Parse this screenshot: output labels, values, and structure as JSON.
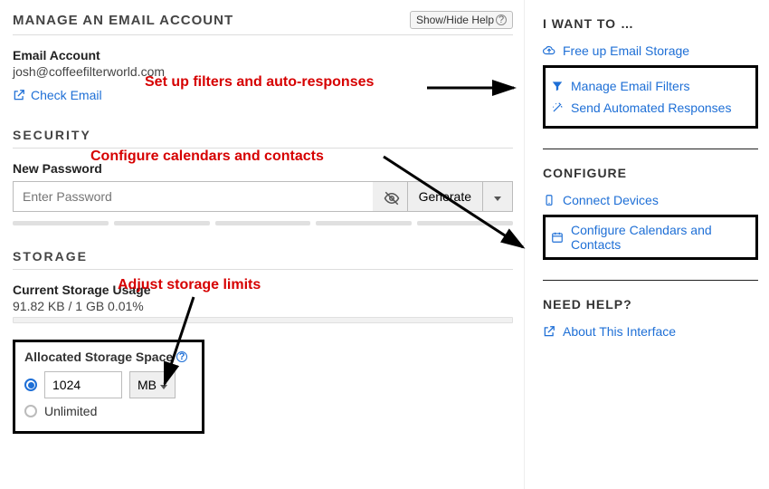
{
  "header": {
    "title": "Manage an Email Account",
    "help_button": "Show/Hide Help"
  },
  "account": {
    "label": "Email Account",
    "email": "josh@coffeefilterworld.com",
    "check_email": "Check Email"
  },
  "security": {
    "title": "Security",
    "new_password_label": "New Password",
    "placeholder": "Enter Password",
    "generate": "Generate"
  },
  "storage": {
    "title": "Storage",
    "current_usage_label": "Current Storage Usage",
    "current_usage_value": "91.82 KB / 1 GB 0.01%",
    "allocated_label": "Allocated Storage Space",
    "allocated_value": "1024",
    "unit": "MB",
    "unlimited": "Unlimited"
  },
  "sidebar": {
    "i_want_to": "I Want To …",
    "free_up": "Free up Email Storage",
    "manage_filters": "Manage Email Filters",
    "send_automated": "Send Automated Responses",
    "configure": "Configure",
    "connect_devices": "Connect Devices",
    "configure_cal": "Configure Calendars and Contacts",
    "need_help": "Need Help?",
    "about": "About This Interface"
  },
  "annotations": {
    "filters": "Set up filters and auto-responses",
    "calendars": "Configure calendars and contacts",
    "storage": "Adjust storage limits"
  }
}
